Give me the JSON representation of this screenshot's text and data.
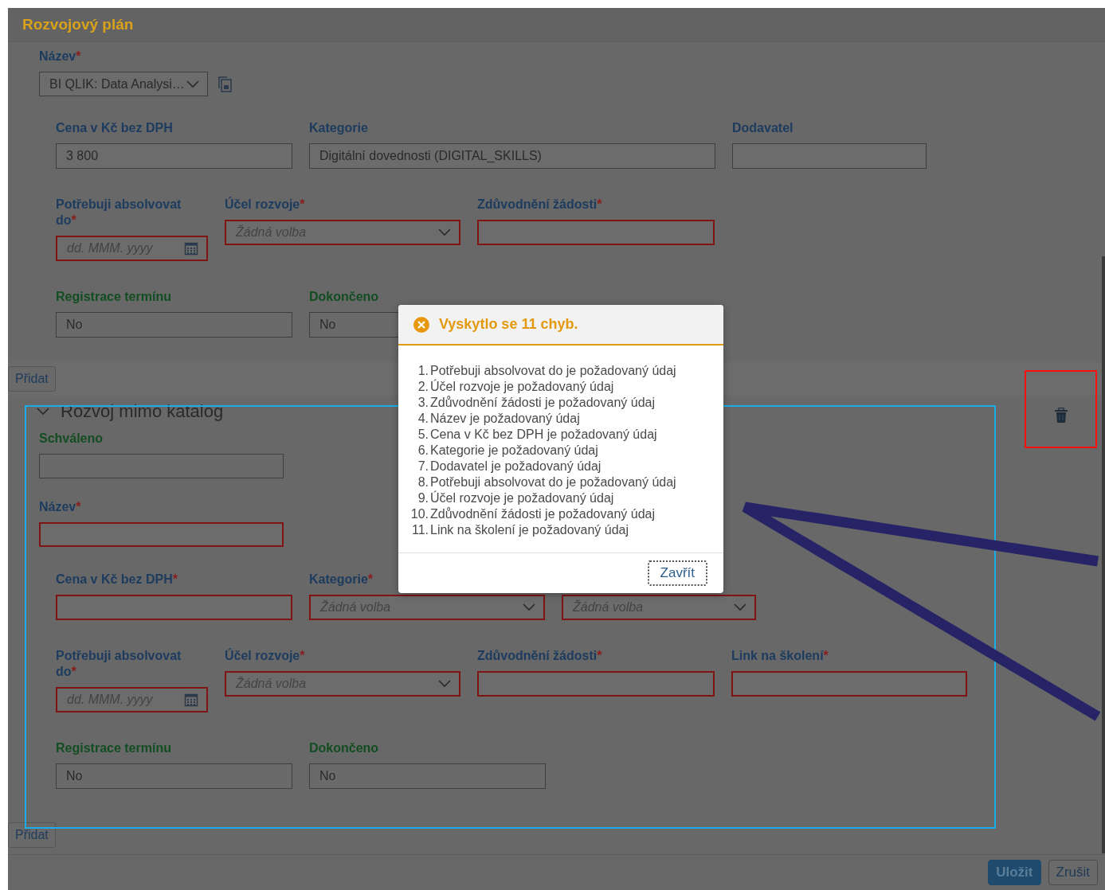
{
  "page": {
    "title": "Rozvojový plán"
  },
  "sections": [
    {
      "top_fields": [
        {
          "label": "Název",
          "required_mark": "*",
          "kind": "select",
          "value": "BI QLIK: Data Analysi…",
          "error": false,
          "copy": true
        }
      ],
      "rows": [
        [
          {
            "label": "Cena v Kč bez DPH",
            "kind": "text",
            "value": "3 800",
            "error": false
          },
          {
            "label": "Kategorie",
            "kind": "text",
            "value": "Digitální dovednosti (DIGITAL_SKILLS)",
            "error": false
          },
          {
            "label": "Dodavatel",
            "kind": "text",
            "error": false
          }
        ],
        [
          {
            "label": "Potřebuji absolvovat do",
            "required_mark": "*",
            "kind": "date",
            "placeholder": "dd. MMM. yyyy",
            "error": true
          },
          {
            "label": "Účel rozvoje",
            "required_mark": "*",
            "kind": "select",
            "placeholder": "Žádná volba",
            "error": true
          },
          {
            "label": "Zdůvodnění žádosti",
            "required_mark": "*",
            "kind": "text",
            "error": true
          }
        ],
        [
          {
            "label": "Registrace termínu",
            "kind": "status",
            "value": "No",
            "error": false
          },
          {
            "label": "Dokončeno",
            "kind": "status",
            "value": "No",
            "error": false
          }
        ]
      ],
      "add_button": "Přidat"
    },
    {
      "title": "Rozvoj mimo katalog",
      "expanded": true,
      "top_fields": [
        {
          "label": "Schváleno",
          "kind": "status",
          "error": false
        },
        {
          "label": "Název",
          "required_mark": "*",
          "kind": "text",
          "error": true
        }
      ],
      "rows": [
        [
          {
            "label": "Cena v Kč bez DPH",
            "required_mark": "*",
            "kind": "text",
            "error": true
          },
          {
            "label": "Kategorie",
            "required_mark": "*",
            "kind": "select",
            "placeholder": "Žádná volba",
            "error": true
          },
          {
            "kind": "select",
            "placeholder": "Žádná volba",
            "error": true
          }
        ],
        [
          {
            "label": "Potřebuji absolvovat do",
            "required_mark": "*",
            "kind": "date",
            "placeholder": "dd. MMM. yyyy",
            "error": true
          },
          {
            "label": "Účel rozvoje",
            "required_mark": "*",
            "kind": "select",
            "placeholder": "Žádná volba",
            "error": true
          },
          {
            "label": "Zdůvodnění žádosti",
            "required_mark": "*",
            "kind": "text",
            "error": true
          },
          {
            "label": "Link na školení",
            "required_mark": "*",
            "kind": "text",
            "error": true
          }
        ],
        [
          {
            "label": "Registrace termínu",
            "kind": "status",
            "value": "No",
            "error": false
          },
          {
            "label": "Dokončeno",
            "kind": "status",
            "value": "No",
            "error": false
          }
        ]
      ],
      "add_button": "Přidat"
    }
  ],
  "footer": {
    "buttons": [
      {
        "label": "Uložit",
        "kind": "primary"
      },
      {
        "label": "Zrušit",
        "kind": "secondary"
      }
    ]
  },
  "dialog": {
    "title": "Vyskytlo se 11 chyb.",
    "items": [
      {
        "number": "1.",
        "text": "Potřebuji absolvovat do je požadovaný údaj"
      },
      {
        "number": "2.",
        "text": "Účel rozvoje je požadovaný údaj"
      },
      {
        "number": "3.",
        "text": "Zdůvodnění žádosti je požadovaný údaj"
      },
      {
        "number": "4.",
        "text": "Název je požadovaný údaj"
      },
      {
        "number": "5.",
        "text": "Cena v Kč bez DPH je požadovaný údaj"
      },
      {
        "number": "6.",
        "text": "Kategorie je požadovaný údaj"
      },
      {
        "number": "7.",
        "text": "Dodavatel je požadovaný údaj"
      },
      {
        "number": "8.",
        "text": "Potřebuji absolvovat do je požadovaný údaj"
      },
      {
        "number": "9.",
        "text": "Účel rozvoje je požadovaný údaj"
      },
      {
        "number": "10.",
        "text": "Zdůvodnění žádosti je požadovaný údaj"
      },
      {
        "number": "11.",
        "text": "Link na školení je požadovaný údaj"
      }
    ],
    "close_button": "Zavřít"
  }
}
